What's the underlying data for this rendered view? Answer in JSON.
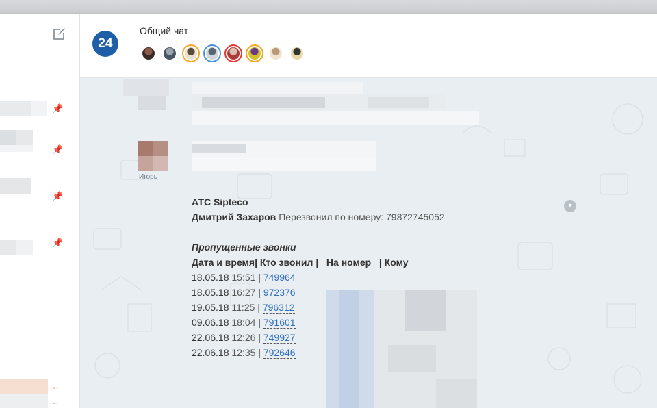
{
  "sidebar": {
    "compose_icon": "compose-icon",
    "pin_icon": "pin-icon"
  },
  "header": {
    "logo": "24",
    "title": "Общий чат",
    "participants": [
      {
        "colors": [
          "#3a2a26",
          "#8a5a4a"
        ],
        "ring": "#ffffff"
      },
      {
        "colors": [
          "#4a5562",
          "#9aa5b0"
        ],
        "ring": "#ffffff"
      },
      {
        "colors": [
          "#e9e0d0",
          "#5c4a3a"
        ],
        "ring": "#f5a623"
      },
      {
        "colors": [
          "#cfd6dc",
          "#596570"
        ],
        "ring": "#4a90e2"
      },
      {
        "colors": [
          "#b03a3a",
          "#d9c0b0"
        ],
        "ring": "#e5383b"
      },
      {
        "colors": [
          "#d4c02a",
          "#6a3a8a"
        ],
        "ring": "#f5a623"
      },
      {
        "colors": [
          "#f1e3d0",
          "#b89a7a"
        ],
        "ring": "#ffffff"
      },
      {
        "colors": [
          "#e9d8a8",
          "#333333"
        ],
        "ring": "#ffffff"
      }
    ]
  },
  "chat": {
    "author_name": "Игорь",
    "bot_name": "АТС Sipteco",
    "caller_name": "Дмитрий Захаров",
    "callback_text": "Перезвонил по номеру: 79872745052",
    "missed_title": "Пропущенные звонки",
    "table_header": "Дата и время| Кто звонил |   На номер   | Кому",
    "rows": [
      {
        "date": "18.05.18",
        "time": "15:51",
        "number": "749964"
      },
      {
        "date": "18.05.18",
        "time": "16:27",
        "number": "972376"
      },
      {
        "date": "19.05.18",
        "time": "11:25",
        "number": "796312"
      },
      {
        "date": "09.06.18",
        "time": "18:04",
        "number": "791601"
      },
      {
        "date": "22.06.18",
        "time": "12:26",
        "number": "749927"
      },
      {
        "date": "22.06.18",
        "time": "12:35",
        "number": "792646"
      }
    ],
    "separator": " | ",
    "menu_icon": "chevron-down-icon"
  }
}
